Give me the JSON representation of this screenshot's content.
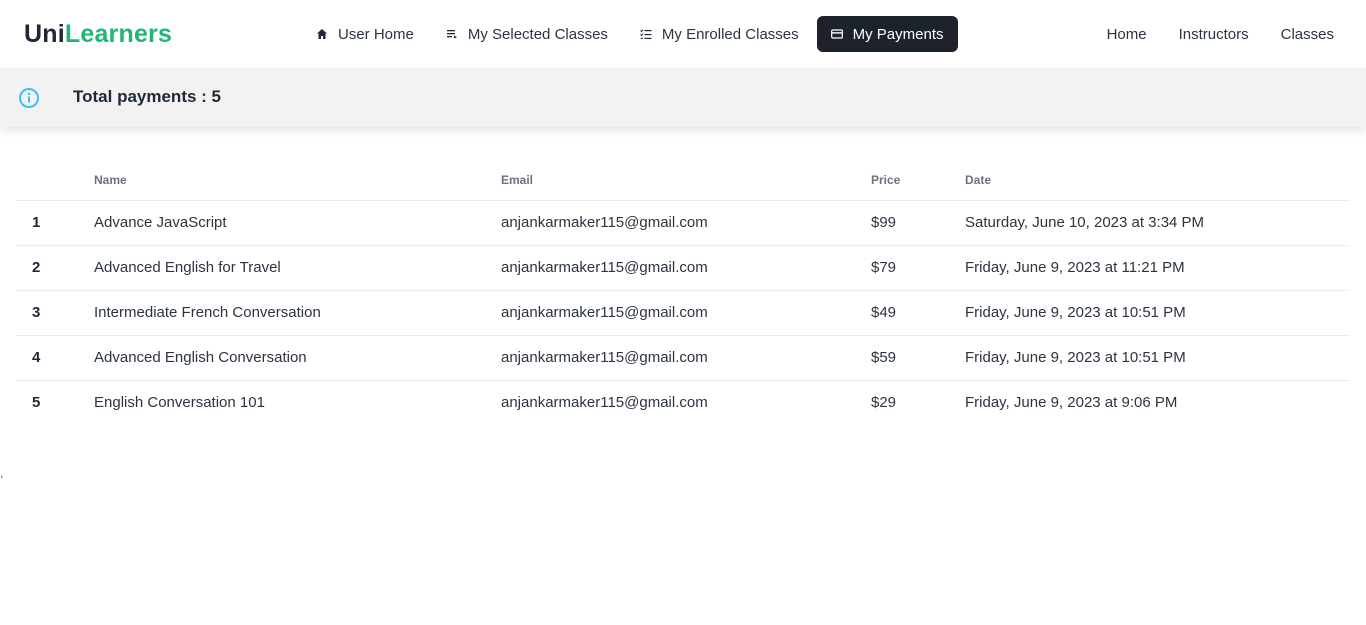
{
  "brand": {
    "part1": "Uni",
    "part2": "Learners"
  },
  "tabs": [
    {
      "label": "User Home",
      "icon": "home-icon"
    },
    {
      "label": "My Selected Classes",
      "icon": "list-icon"
    },
    {
      "label": "My Enrolled Classes",
      "icon": "checklist-icon"
    },
    {
      "label": "My Payments",
      "icon": "card-icon",
      "active": true
    }
  ],
  "nav": [
    "Home",
    "Instructors",
    "Classes"
  ],
  "summary": {
    "icon": "info-icon",
    "text": "Total payments : 5"
  },
  "table": {
    "headers": [
      "",
      "Name",
      "Email",
      "Price",
      "Date"
    ],
    "rows": [
      {
        "index": "1",
        "name": "Advance JavaScript",
        "email": "anjankarmaker115@gmail.com",
        "price": "$99",
        "date": "Saturday, June 10, 2023 at 3:34 PM"
      },
      {
        "index": "2",
        "name": "Advanced English for Travel",
        "email": "anjankarmaker115@gmail.com",
        "price": "$79",
        "date": "Friday, June 9, 2023 at 11:21 PM"
      },
      {
        "index": "3",
        "name": "Intermediate French Conversation",
        "email": "anjankarmaker115@gmail.com",
        "price": "$49",
        "date": "Friday, June 9, 2023 at 10:51 PM"
      },
      {
        "index": "4",
        "name": "Advanced English Conversation",
        "email": "anjankarmaker115@gmail.com",
        "price": "$59",
        "date": "Friday, June 9, 2023 at 10:51 PM"
      },
      {
        "index": "5",
        "name": "English Conversation 101",
        "email": "anjankarmaker115@gmail.com",
        "price": "$29",
        "date": "Friday, June 9, 2023 at 9:06 PM"
      }
    ]
  },
  "stray_mark": ",",
  "colors": {
    "brand_green": "#22b573",
    "active_tab_bg": "#1d232a",
    "info_blue": "#3abff8"
  }
}
